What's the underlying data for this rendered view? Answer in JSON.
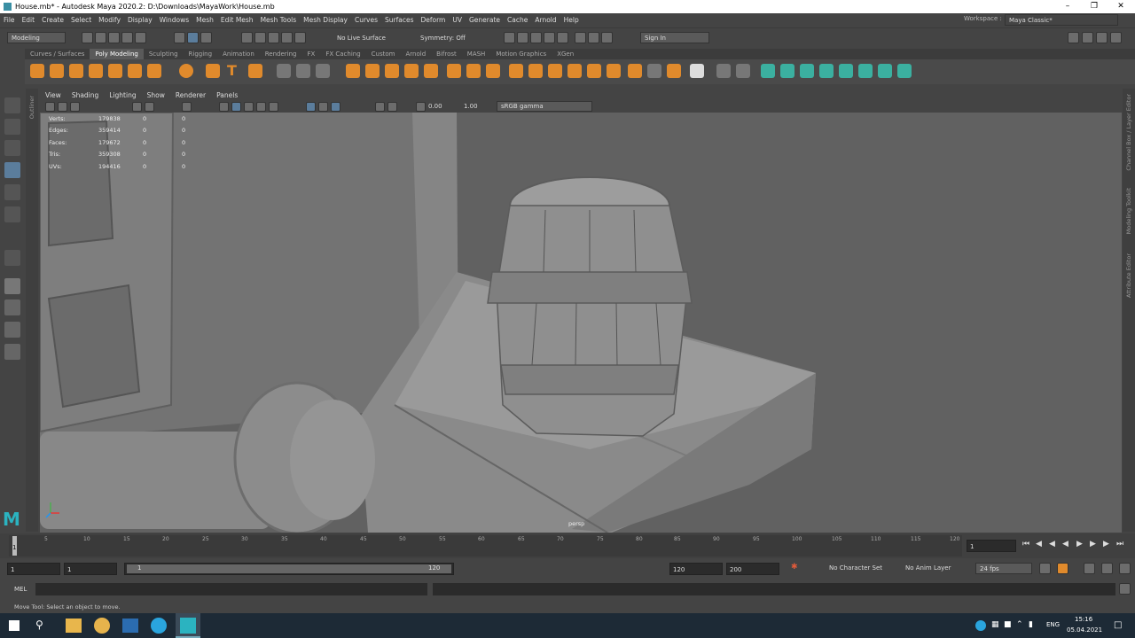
{
  "window": {
    "title": "House.mb* - Autodesk Maya 2020.2: D:\\Downloads\\MayaWork\\House.mb"
  },
  "menu": [
    "File",
    "Edit",
    "Create",
    "Select",
    "Modify",
    "Display",
    "Windows",
    "Mesh",
    "Edit Mesh",
    "Mesh Tools",
    "Mesh Display",
    "Curves",
    "Surfaces",
    "Deform",
    "UV",
    "Generate",
    "Cache",
    "Arnold",
    "Help"
  ],
  "workspace": {
    "label": "Workspace :",
    "value": "Maya Classic*"
  },
  "status": {
    "mode": "Modeling",
    "live_surface": "No Live Surface",
    "symmetry": "Symmetry: Off",
    "sign_in": "Sign In"
  },
  "shelf_tabs": [
    "Curves / Surfaces",
    "Poly Modeling",
    "Sculpting",
    "Rigging",
    "Animation",
    "Rendering",
    "FX",
    "FX Caching",
    "Custom",
    "Arnold",
    "Bifrost",
    "MASH",
    "Motion Graphics",
    "XGen"
  ],
  "panel_menu": [
    "View",
    "Shading",
    "Lighting",
    "Show",
    "Renderer",
    "Panels"
  ],
  "panel_toolbar": {
    "near": "0.00",
    "far": "1.00",
    "color_space": "sRGB gamma"
  },
  "hud": [
    {
      "label": "Verts:",
      "value": "179838",
      "sel": "0",
      "comp": "0"
    },
    {
      "label": "Edges:",
      "value": "359414",
      "sel": "0",
      "comp": "0"
    },
    {
      "label": "Faces:",
      "value": "179672",
      "sel": "0",
      "comp": "0"
    },
    {
      "label": "Tris:",
      "value": "359308",
      "sel": "0",
      "comp": "0"
    },
    {
      "label": "UVs:",
      "value": "194416",
      "sel": "0",
      "comp": "0"
    }
  ],
  "camera_label": "persp",
  "side_tabs": {
    "outliner": "Outliner",
    "channel_box": "Channel Box / Layer Editor",
    "modeling_toolkit": "Modeling Toolkit",
    "attribute_editor": "Attribute Editor"
  },
  "timeline": {
    "ticks": [
      "5",
      "10",
      "15",
      "20",
      "25",
      "30",
      "35",
      "40",
      "45",
      "50",
      "55",
      "60",
      "65",
      "70",
      "75",
      "80",
      "85",
      "90",
      "95",
      "100",
      "105",
      "110",
      "115",
      "120"
    ],
    "start_marker": "1",
    "current": "1"
  },
  "range": {
    "start": "1",
    "anim_start": "1",
    "slider_start": "1",
    "slider_end": "120",
    "end": "120",
    "anim_end": "200",
    "character_set": "No Character Set",
    "anim_layer": "No Anim Layer",
    "fps": "24 fps"
  },
  "mel": {
    "label": "MEL"
  },
  "help_line": "Move Tool: Select an object to move.",
  "taskbar": {
    "lang": "ENG",
    "time": "15:16",
    "date": "05.04.2021"
  }
}
